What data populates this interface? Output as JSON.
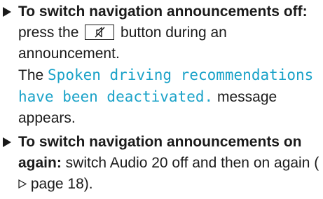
{
  "steps": [
    {
      "heading": "To switch navigation announcements off:",
      "text_before_key": " press the ",
      "key_icon": "mute-speaker-icon",
      "text_after_key": " button during an announcement.",
      "line2_prefix": "The ",
      "display_message": "Spoken driving recommendations have been deactivated.",
      "line2_suffix": " message appears."
    },
    {
      "heading": "To switch navigation announcements on again:",
      "text": " switch Audio 20 off and then on again (",
      "xref_icon": "page-reference-triangle-icon",
      "xref_text": " page 18).",
      "trailing": ""
    }
  ],
  "colors": {
    "text": "#1a1a1a",
    "display_message": "#1aa2c8"
  }
}
